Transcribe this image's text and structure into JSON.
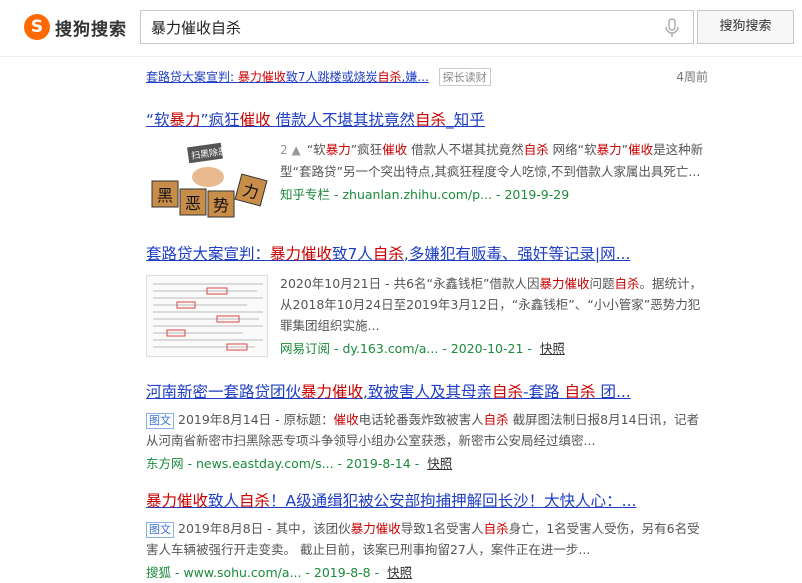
{
  "logo": {
    "mark": "S",
    "text": "搜狗搜索"
  },
  "search": {
    "value": "暴力催收自杀",
    "button_label": "搜狗搜索"
  },
  "top_snippet": {
    "link_parts": [
      "套路贷大案宣判: ",
      "暴力催收",
      "致7人跳楼或烧炭",
      "自杀",
      ",嫌..."
    ],
    "tag": "探长读财",
    "age": "4周前"
  },
  "results": [
    {
      "title_parts": [
        "“软",
        "暴力",
        "”疯狂",
        "催收",
        " 借款人不堪其扰竟然",
        "自杀",
        "_知乎"
      ],
      "vote_count": "2",
      "snippet_parts": [
        "“软",
        "暴力",
        "”疯狂",
        "催收",
        " 借款人不堪其扰竟然",
        "自杀",
        " 网络“软",
        "暴力",
        "”",
        "催收",
        "是这种新型“套路贷”另一个突出特点,其疯狂程度令人吃惊,不到借款人家属出具死亡..."
      ],
      "source": "知乎专栏 - zhuanlan.zhihu.com/p... - 2019-9-29",
      "thumb_text": [
        "扫黑除恶",
        "黑",
        "恶",
        "势",
        "力"
      ]
    },
    {
      "title_parts": [
        "套路贷大案宣判：",
        "暴力催收",
        "致7人",
        "自杀",
        ",多嫌犯有贩毒、强奸等记录|网..."
      ],
      "snippet_parts": [
        "2020年10月21日 - 共6名“永鑫钱柜”借款人因",
        "暴力催收",
        "问题",
        "自杀",
        "。据统计，从2018年10月24日至2019年3月12日，“永鑫钱柜”、“小小管家”恶势力犯罪集团组织实施..."
      ],
      "source": "网易订阅 - dy.163.com/a... - 2020-10-21 - ",
      "cache": "快照"
    },
    {
      "title_parts": [
        "河南新密一套路贷团伙",
        "暴力催收",
        ",致被害人及其母亲",
        "自杀",
        "-套路 ",
        "自杀",
        " 团..."
      ],
      "badge": "图文",
      "snippet_parts": [
        "2019年8月14日 - 原标题：",
        "催收",
        "电话轮番轰炸致被害人",
        "自杀",
        " 截屏图法制日报8月14日讯，记者从河南省新密市扫黑除恶专项斗争领导小组办公室获悉，新密市公安局经过缜密..."
      ],
      "source": "东方网 - news.eastday.com/s... - 2019-8-14 - ",
      "cache": "快照"
    },
    {
      "title_parts": [
        "暴力催收",
        "致人",
        "自杀",
        "！A级通缉犯被公安部拘捕押解回长沙！大快人心：..."
      ],
      "badge": "图文",
      "snippet_parts": [
        "2019年8月8日 - 其中，该团伙",
        "暴力催收",
        "导致1名受害人",
        "自杀",
        "身亡，1名受害人受伤，另有6名受害人车辆被强行开走变卖。 截止目前，该案已刑事拘留27人，案件正在进一步..."
      ],
      "source": "搜狐 - www.sohu.com/a... - 2019-8-8 - ",
      "cache": "快照"
    }
  ],
  "colors": {
    "link": "#1e3ec5",
    "highlight": "#cc0000",
    "source": "#1b8a3a",
    "logo": "#ff6a00"
  }
}
